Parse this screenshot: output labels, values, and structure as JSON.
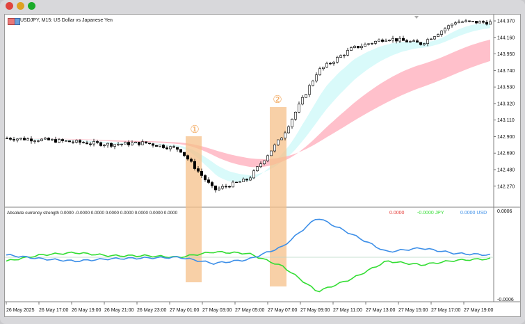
{
  "window": {
    "buttons": [
      {
        "name": "close",
        "color": "#e0443e"
      },
      {
        "name": "minimize",
        "color": "#dea123"
      },
      {
        "name": "zoom",
        "color": "#1aab29"
      }
    ]
  },
  "chart": {
    "symbol_label": "USDJPY, M15:  US Dollar vs Japanese Yen",
    "price_ticks": [
      "144.370",
      "144.160",
      "143.950",
      "143.740",
      "143.530",
      "143.320",
      "143.110",
      "142.900",
      "142.690",
      "142.480",
      "142.270"
    ],
    "annotations": [
      "①",
      "②"
    ],
    "time_ticks": [
      "26 May 2025",
      "26 May 17:00",
      "26 May 19:00",
      "26 May 21:00",
      "26 May 23:00",
      "27 May 01:00",
      "27 May 03:00",
      "27 May 05:00",
      "27 May 07:00",
      "27 May 09:00",
      "27 May 11:00",
      "27 May 13:00",
      "27 May 15:00",
      "27 May 17:00",
      "27 May 19:00"
    ],
    "colors": {
      "fast_cloud": "#d9fafa",
      "slow_cloud": "#ffc0cb",
      "highlight": "#f5c08a",
      "candle": "#000000"
    }
  },
  "indicator": {
    "title": "Absolute currency strength 0.0000 -0.0000 0.0000 0.0000 0.0000 0.0000 0.0000 0.0000",
    "legend": [
      {
        "text": "0.0000",
        "color": "#e53935"
      },
      {
        "text": "-0.0000 JPY",
        "color": "#33dd33"
      },
      {
        "text": "0.0000 USD",
        "color": "#3d8fe8"
      }
    ],
    "scale_top": "0.0006",
    "scale_bottom": "-0.0006"
  },
  "chart_data": {
    "type": "line",
    "title": "USDJPY, M15:  US Dollar vs Japanese Yen",
    "x": [
      "26 May 2025",
      "26 May 17:00",
      "26 May 19:00",
      "26 May 21:00",
      "26 May 23:00",
      "27 May 01:00",
      "27 May 03:00",
      "27 May 05:00",
      "27 May 07:00",
      "27 May 09:00",
      "27 May 11:00",
      "27 May 13:00",
      "27 May 15:00",
      "27 May 17:00",
      "27 May 19:00"
    ],
    "series": [
      {
        "values": [
          142.88,
          142.86,
          142.83,
          142.8,
          142.82,
          142.74,
          142.22,
          142.36,
          142.92,
          143.73,
          144.02,
          144.15,
          144.08,
          144.36,
          144.35
        ]
      },
      {
        "name": "JPY",
        "values": [
          -5e-05,
          3e-05,
          6e-05,
          2e-05,
          2e-05,
          0.0,
          7e-05,
          5e-05,
          -0.00012,
          -0.00045,
          -0.00028,
          -5e-05,
          -0.0001,
          -4e-05,
          -2e-05
        ]
      },
      {
        "name": "USD",
        "values": [
          3e-05,
          -2e-05,
          -5e-05,
          -2e-05,
          -1e-05,
          0.0,
          -8e-05,
          -3e-05,
          0.00014,
          0.00052,
          0.0003,
          7e-05,
          0.00012,
          5e-05,
          3e-05
        ]
      }
    ],
    "ylim": [
      142.1,
      144.45
    ]
  }
}
